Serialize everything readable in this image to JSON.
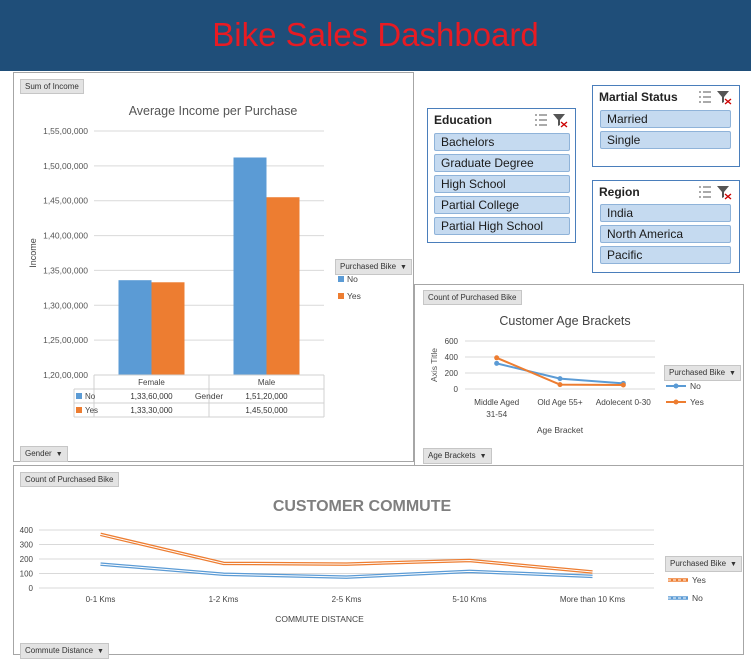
{
  "header": {
    "title": "Bike Sales Dashboard"
  },
  "income_panel": {
    "pivot_value_button": "Sum of Income",
    "axis_button": "Gender",
    "legend_button": "Purchased Bike",
    "table": {
      "columns": [
        "Female",
        "Male"
      ],
      "rows": [
        {
          "label": "No",
          "values": [
            "1,33,60,000",
            "1,51,20,000"
          ]
        },
        {
          "label": "Yes",
          "values": [
            "1,33,30,000",
            "1,45,50,000"
          ]
        }
      ],
      "overlay_label": "Gender"
    }
  },
  "age_panel": {
    "pivot_value_button": "Count of Purchased Bike",
    "axis_button": "Age Brackets",
    "legend_button": "Purchased Bike"
  },
  "commute_panel": {
    "pivot_value_button": "Count of Purchased Bike",
    "axis_button": "Commute Distance",
    "legend_button": "Purchased Bike"
  },
  "slicers": {
    "education": {
      "title": "Education",
      "items": [
        "Bachelors",
        "Graduate Degree",
        "High School",
        "Partial College",
        "Partial High School"
      ]
    },
    "marital": {
      "title": "Martial Status",
      "items": [
        "Married",
        "Single"
      ]
    },
    "region": {
      "title": "Region",
      "items": [
        "India",
        "North America",
        "Pacific"
      ]
    }
  },
  "chart_data": [
    {
      "type": "bar",
      "title": "Average Income per Purchase",
      "xlabel": "",
      "ylabel": "Income",
      "categories": [
        "Female",
        "Male"
      ],
      "series": [
        {
          "name": "No",
          "values": [
            13360000,
            15120000
          ],
          "color": "#5b9bd5"
        },
        {
          "name": "Yes",
          "values": [
            13330000,
            14550000
          ],
          "color": "#ed7d31"
        }
      ],
      "ylim": [
        12000000,
        15500000
      ],
      "yticks": [
        12000000,
        12500000,
        13000000,
        13500000,
        14000000,
        14500000,
        15000000,
        15500000
      ],
      "ytick_labels": [
        "1,20,00,000",
        "1,25,00,000",
        "1,30,00,000",
        "1,35,00,000",
        "1,40,00,000",
        "1,45,00,000",
        "1,50,00,000",
        "1,55,00,000"
      ],
      "grid": true,
      "legend": "right"
    },
    {
      "type": "line",
      "title": "Customer Age Brackets",
      "xlabel": "Age Bracket",
      "ylabel": "Axis Title",
      "categories": [
        "Middle Aged 31-54",
        "Old Age 55+",
        "Adolecent 0-30"
      ],
      "category_lines": [
        [
          "Middle Aged",
          "31-54"
        ],
        [
          "Old Age 55+"
        ],
        [
          "Adolecent 0-30"
        ]
      ],
      "series": [
        {
          "name": "No",
          "values": [
            320,
            130,
            70
          ],
          "color": "#5b9bd5"
        },
        {
          "name": "Yes",
          "values": [
            390,
            55,
            50
          ],
          "color": "#ed7d31"
        }
      ],
      "ylim": [
        0,
        600
      ],
      "yticks": [
        0,
        200,
        400,
        600
      ],
      "ytick_labels": [
        "0",
        "200",
        "400",
        "600"
      ],
      "grid": true,
      "legend": "right"
    },
    {
      "type": "line",
      "title": "CUSTOMER COMMUTE",
      "xlabel": "COMMUTE DISTANCE",
      "ylabel": "",
      "categories": [
        "0-1 Kms",
        "1-2 Kms",
        "2-5 Kms",
        "5-10 Kms",
        "More than 10 Kms"
      ],
      "series": [
        {
          "name": "Yes",
          "values": [
            370,
            170,
            165,
            190,
            110
          ],
          "color": "#ed7d31"
        },
        {
          "name": "No",
          "values": [
            165,
            95,
            75,
            115,
            80
          ],
          "color": "#5b9bd5"
        }
      ],
      "ylim": [
        0,
        400
      ],
      "yticks": [
        0,
        100,
        200,
        300,
        400
      ],
      "ytick_labels": [
        "0",
        "100",
        "200",
        "300",
        "400"
      ],
      "grid": true,
      "legend": "right"
    }
  ]
}
